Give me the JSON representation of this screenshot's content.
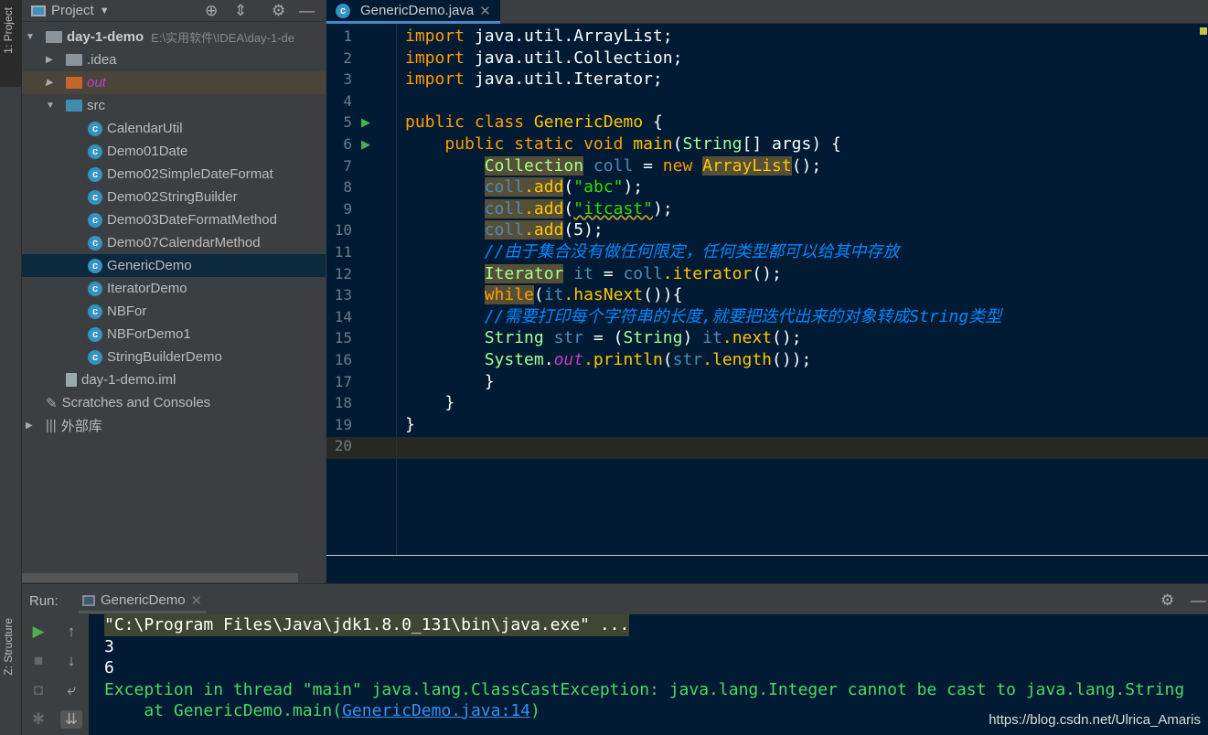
{
  "left_strip": {
    "project_tab": "1: Project",
    "structure_tab": "Z: Structure"
  },
  "project_panel": {
    "title": "Project",
    "tree": [
      {
        "label": "day-1-demo",
        "path": "E:\\实用软件\\IDEA\\day-1-de",
        "type": "module"
      },
      {
        "label": ".idea",
        "type": "folder"
      },
      {
        "label": "out",
        "type": "folder-excluded"
      },
      {
        "label": "src",
        "type": "source-folder"
      },
      {
        "label": "CalendarUtil",
        "type": "class"
      },
      {
        "label": "Demo01Date",
        "type": "class"
      },
      {
        "label": "Demo02SimpleDateFormat",
        "type": "class"
      },
      {
        "label": "Demo02StringBuilder",
        "type": "class"
      },
      {
        "label": "Demo03DateFormatMethod",
        "type": "class"
      },
      {
        "label": "Demo07CalendarMethod",
        "type": "class"
      },
      {
        "label": "GenericDemo",
        "type": "class",
        "selected": true
      },
      {
        "label": "IteratorDemo",
        "type": "class"
      },
      {
        "label": "NBFor",
        "type": "class"
      },
      {
        "label": "NBForDemo1",
        "type": "class"
      },
      {
        "label": "StringBuilderDemo",
        "type": "class"
      },
      {
        "label": "day-1-demo.iml",
        "type": "file"
      },
      {
        "label": "Scratches and Consoles",
        "type": "scratches"
      },
      {
        "label": "外部库",
        "type": "libraries"
      }
    ]
  },
  "editor": {
    "tab": "GenericDemo.java",
    "line_numbers": [
      "1",
      "2",
      "3",
      "4",
      "5",
      "6",
      "7",
      "8",
      "9",
      "10",
      "11",
      "12",
      "13",
      "14",
      "15",
      "16",
      "17",
      "18",
      "19",
      "20"
    ],
    "lines": [
      [
        [
          "kw",
          "import "
        ],
        [
          "",
          "java.util.ArrayList;"
        ]
      ],
      [
        [
          "kw",
          "import "
        ],
        [
          "",
          "java.util.Collection;"
        ]
      ],
      [
        [
          "kw",
          "import "
        ],
        [
          "",
          "java.util.Iterator;"
        ]
      ],
      [],
      [
        [
          "kw",
          "public class "
        ],
        [
          "ty",
          "GenericDemo "
        ],
        [
          "",
          "{"
        ]
      ],
      [
        [
          "",
          "    "
        ],
        [
          "kw",
          "public static void "
        ],
        [
          "ty",
          "main"
        ],
        [
          "",
          "("
        ],
        [
          "gr",
          "String"
        ],
        [
          "",
          "[] args) {"
        ]
      ],
      [
        [
          "",
          "        "
        ],
        [
          "gr hl",
          "Collection"
        ],
        [
          "var",
          " coll"
        ],
        [
          "",
          " = "
        ],
        [
          "kw",
          "new "
        ],
        [
          "ty hl",
          "ArrayList"
        ],
        [
          "",
          "();"
        ]
      ],
      [
        [
          "",
          "        "
        ],
        [
          "var hl",
          "coll"
        ],
        [
          "ty hl",
          ".add"
        ],
        [
          "",
          "("
        ],
        [
          "str",
          "\"abc\""
        ],
        [
          "",
          ");"
        ]
      ],
      [
        [
          "",
          "        "
        ],
        [
          "var hl",
          "coll"
        ],
        [
          "ty hl",
          ".add"
        ],
        [
          "",
          "("
        ],
        [
          "str squig",
          "\"itcast\""
        ],
        [
          "",
          ");"
        ]
      ],
      [
        [
          "",
          "        "
        ],
        [
          "var hl",
          "coll"
        ],
        [
          "ty hl",
          ".add"
        ],
        [
          "",
          "(5);"
        ]
      ],
      [
        [
          "",
          "        "
        ],
        [
          "cm",
          "//由于集合没有做任何限定，任何类型都可以给其中存放"
        ]
      ],
      [
        [
          "",
          "        "
        ],
        [
          "gr hl",
          "Iterator"
        ],
        [
          "var",
          " it"
        ],
        [
          "",
          " = "
        ],
        [
          "var",
          "coll"
        ],
        [
          "ty",
          ".iterator"
        ],
        [
          "",
          "();"
        ]
      ],
      [
        [
          "",
          "        "
        ],
        [
          "kw hl",
          "while"
        ],
        [
          "",
          "("
        ],
        [
          "var",
          "it"
        ],
        [
          "ty",
          ".hasNext"
        ],
        [
          "",
          "()){"
        ]
      ],
      [
        [
          "",
          "        "
        ],
        [
          "cm",
          "//需要打印每个字符串的长度,就要把迭代出来的对象转成String类型"
        ]
      ],
      [
        [
          "",
          "        "
        ],
        [
          "gr",
          "String"
        ],
        [
          "var",
          " str"
        ],
        [
          "",
          " = ("
        ],
        [
          "gr",
          "String"
        ],
        [
          "",
          ") "
        ],
        [
          "var",
          "it"
        ],
        [
          "ty",
          ".next"
        ],
        [
          "",
          "();"
        ]
      ],
      [
        [
          "",
          "        "
        ],
        [
          "gr",
          "System"
        ],
        [
          "",
          "."
        ],
        [
          "out",
          "out"
        ],
        [
          "ty",
          ".println"
        ],
        [
          "",
          "("
        ],
        [
          "var",
          "str"
        ],
        [
          "ty",
          ".length"
        ],
        [
          "",
          "());"
        ]
      ],
      [
        [
          "",
          "        }"
        ]
      ],
      [
        [
          "",
          "    }"
        ]
      ],
      [
        [
          "",
          "}"
        ]
      ],
      []
    ]
  },
  "run_panel": {
    "label": "Run:",
    "tab": "GenericDemo",
    "console": [
      {
        "text": "\"C:\\Program Files\\Java\\jdk1.8.0_131\\bin\\java.exe\" ...",
        "style": "cmd"
      },
      {
        "text": "3",
        "style": "out"
      },
      {
        "text": "6",
        "style": "out"
      },
      {
        "text": "Exception in thread \"main\" java.lang.ClassCastException: java.lang.Integer cannot be cast to java.lang.String",
        "style": "err"
      }
    ],
    "trace_prefix": "    at GenericDemo.main(",
    "trace_link": "GenericDemo.java:14",
    "trace_suffix": ")"
  },
  "watermark": "https://blog.csdn.net/Ulrica_Amaris"
}
